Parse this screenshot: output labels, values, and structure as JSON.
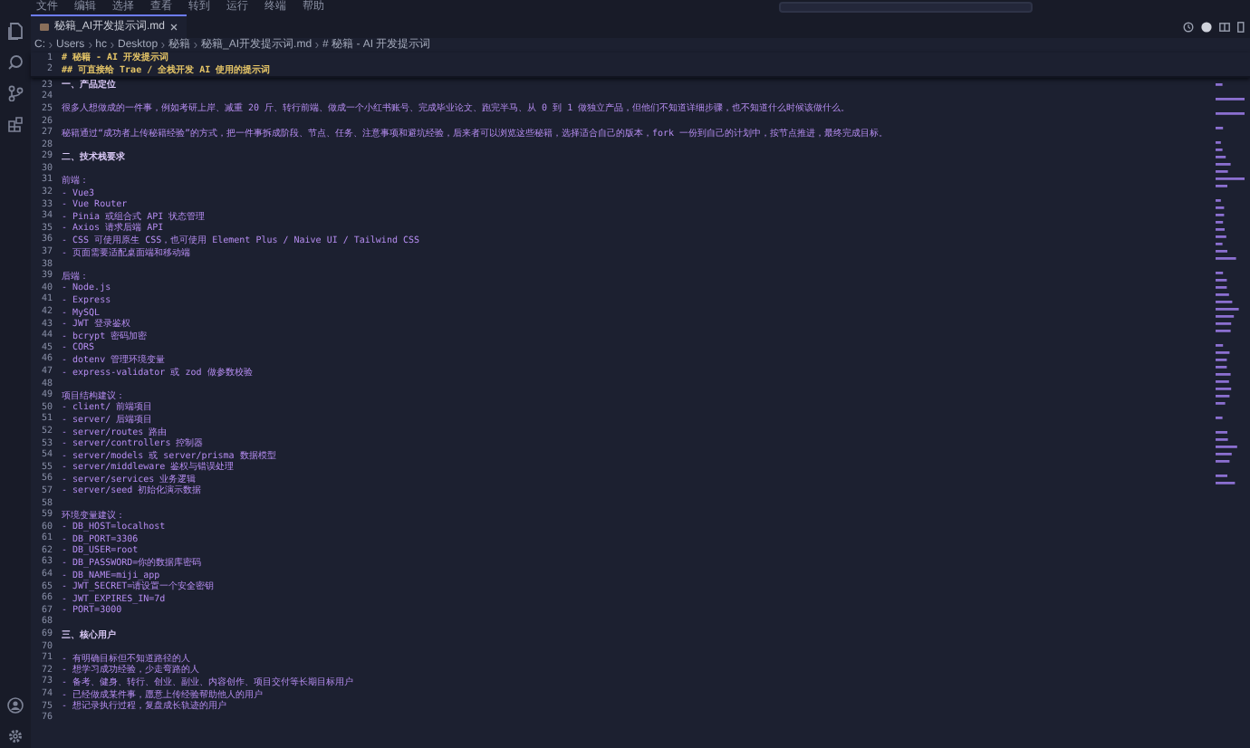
{
  "menu": [
    "文件",
    "编辑",
    "选择",
    "查看",
    "转到",
    "运行",
    "终端",
    "帮助"
  ],
  "tabs": [
    {
      "label": "秘籍_AI开发提示词.md",
      "selected": true
    }
  ],
  "breadcrumb": [
    "C:",
    "Users",
    "hc",
    "Desktop",
    "秘籍",
    "秘籍_AI开发提示词.md",
    "# 秘籍 - AI 开发提示词"
  ],
  "sticky_lines": [
    {
      "number": "1",
      "text": "# 秘籍 - AI 开发提示词",
      "kind": "heading"
    },
    {
      "number": "2",
      "text": "## 可直接给 Trae / 全栈开发 AI 使用的提示词",
      "kind": "heading"
    }
  ],
  "lines": [
    {
      "number": "23",
      "text": "一、产品定位",
      "kind": "section"
    },
    {
      "number": "24"
    },
    {
      "number": "25",
      "text": "很多人想做成的一件事，例如考研上岸、减重 20 斤、转行前端、做成一个小红书账号、完成毕业论文、跑完半马、从 0 到 1 做独立产品，但他们不知道详细步骤，也不知道什么时候该做什么。",
      "kind": "text"
    },
    {
      "number": "26"
    },
    {
      "number": "27",
      "text": "秘籍通过“成功者上传秘籍经验”的方式，把一件事拆成阶段、节点、任务、注意事项和避坑经验，后来者可以浏览这些秘籍，选择适合自己的版本，fork 一份到自己的计划中，按节点推进，最终完成目标。",
      "kind": "text"
    },
    {
      "number": "28"
    },
    {
      "number": "29",
      "text": "二、技术栈要求",
      "kind": "section"
    },
    {
      "number": "30"
    },
    {
      "number": "31",
      "text": "前端：",
      "kind": "text"
    },
    {
      "number": "32",
      "text": "- Vue3",
      "kind": "text"
    },
    {
      "number": "33",
      "text": "- Vue Router",
      "kind": "text"
    },
    {
      "number": "34",
      "text": "- Pinia 或组合式 API 状态管理",
      "kind": "text"
    },
    {
      "number": "35",
      "text": "- Axios 请求后端 API",
      "kind": "text"
    },
    {
      "number": "36",
      "text": "- CSS 可使用原生 CSS，也可使用 Element Plus / Naive UI / Tailwind CSS",
      "kind": "text"
    },
    {
      "number": "37",
      "text": "- 页面需要适配桌面端和移动端",
      "kind": "text"
    },
    {
      "number": "38"
    },
    {
      "number": "39",
      "text": "后端：",
      "kind": "text"
    },
    {
      "number": "40",
      "text": "- Node.js",
      "kind": "text"
    },
    {
      "number": "41",
      "text": "- Express",
      "kind": "text"
    },
    {
      "number": "42",
      "text": "- MySQL",
      "kind": "text"
    },
    {
      "number": "43",
      "text": "- JWT 登录鉴权",
      "kind": "text"
    },
    {
      "number": "44",
      "text": "- bcrypt 密码加密",
      "kind": "text"
    },
    {
      "number": "45",
      "text": "- CORS",
      "kind": "text"
    },
    {
      "number": "46",
      "text": "- dotenv 管理环境变量",
      "kind": "text"
    },
    {
      "number": "47",
      "text": "- express-validator 或 zod 做参数校验",
      "kind": "text"
    },
    {
      "number": "48"
    },
    {
      "number": "49",
      "text": "项目结构建议：",
      "kind": "text"
    },
    {
      "number": "50",
      "text": "- client/ 前端项目",
      "kind": "text"
    },
    {
      "number": "51",
      "text": "- server/ 后端项目",
      "kind": "text"
    },
    {
      "number": "52",
      "text": "- server/routes 路由",
      "kind": "text"
    },
    {
      "number": "53",
      "text": "- server/controllers 控制器",
      "kind": "text"
    },
    {
      "number": "54",
      "text": "- server/models 或 server/prisma 数据模型",
      "kind": "text"
    },
    {
      "number": "55",
      "text": "- server/middleware 鉴权与错误处理",
      "kind": "text"
    },
    {
      "number": "56",
      "text": "- server/services 业务逻辑",
      "kind": "text"
    },
    {
      "number": "57",
      "text": "- server/seed 初始化演示数据",
      "kind": "text"
    },
    {
      "number": "58"
    },
    {
      "number": "59",
      "text": "环境变量建议：",
      "kind": "text"
    },
    {
      "number": "60",
      "text": "- DB_HOST=localhost",
      "kind": "text"
    },
    {
      "number": "61",
      "text": "- DB_PORT=3306",
      "kind": "text"
    },
    {
      "number": "62",
      "text": "- DB_USER=root",
      "kind": "text"
    },
    {
      "number": "63",
      "text": "- DB_PASSWORD=你的数据库密码",
      "kind": "text"
    },
    {
      "number": "64",
      "text": "- DB_NAME=miji_app",
      "kind": "text"
    },
    {
      "number": "65",
      "text": "- JWT_SECRET=请设置一个安全密钥",
      "kind": "text"
    },
    {
      "number": "66",
      "text": "- JWT_EXPIRES_IN=7d",
      "kind": "text"
    },
    {
      "number": "67",
      "text": "- PORT=3000",
      "kind": "text"
    },
    {
      "number": "68"
    },
    {
      "number": "69",
      "text": "三、核心用户",
      "kind": "section"
    },
    {
      "number": "70"
    },
    {
      "number": "71",
      "text": "- 有明确目标但不知道路径的人",
      "kind": "text"
    },
    {
      "number": "72",
      "text": "- 想学习成功经验，少走弯路的人",
      "kind": "text"
    },
    {
      "number": "73",
      "text": "- 备考、健身、转行、创业、副业、内容创作、项目交付等长期目标用户",
      "kind": "text"
    },
    {
      "number": "74",
      "text": "- 已经做成某件事，愿意上传经验帮助他人的用户",
      "kind": "text"
    },
    {
      "number": "75",
      "text": "- 想记录执行过程，复盘成长轨迹的用户",
      "kind": "text"
    },
    {
      "number": "76"
    }
  ]
}
